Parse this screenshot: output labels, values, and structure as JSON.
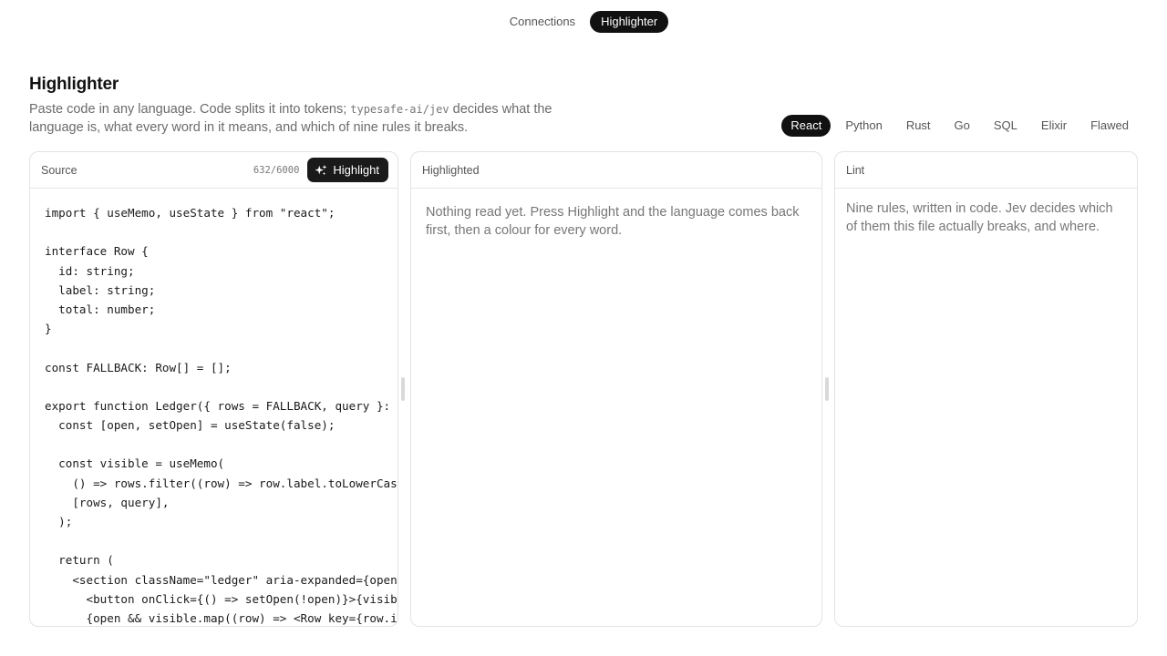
{
  "nav": {
    "tabs": [
      {
        "label": "Connections",
        "active": false
      },
      {
        "label": "Highlighter",
        "active": true
      }
    ]
  },
  "page": {
    "title": "Highlighter",
    "desc_before": "Paste code in any language. Code splits it into tokens; ",
    "desc_code": "typesafe-ai/jev",
    "desc_after": " decides what the language is, what every word in it means, and which of nine rules it breaks."
  },
  "languages": [
    {
      "label": "React",
      "active": true
    },
    {
      "label": "Python",
      "active": false
    },
    {
      "label": "Rust",
      "active": false
    },
    {
      "label": "Go",
      "active": false
    },
    {
      "label": "SQL",
      "active": false
    },
    {
      "label": "Elixir",
      "active": false
    },
    {
      "label": "Flawed",
      "active": false
    }
  ],
  "source": {
    "title": "Source",
    "counter": "632/6000",
    "button_label": "Highlight",
    "button_icon": "sparkles-icon",
    "code_lines": [
      "import { useMemo, useState } from \"react\";",
      "",
      "interface Row {",
      "  id: string;",
      "  label: string;",
      "  total: number;",
      "}",
      "",
      "const FALLBACK: Row[] = [];",
      "",
      "export function Ledger({ rows = FALLBACK, query }: {",
      "  const [open, setOpen] = useState(false);",
      "",
      "  const visible = useMemo(",
      "    () => rows.filter((row) => row.label.toLowerCase",
      "    [rows, query],",
      "  );",
      "",
      "  return (",
      "    <section className=\"ledger\" aria-expanded={open}",
      "      <button onClick={() => setOpen(!open)}>{visibl",
      "      {open && visible.map((row) => <Row key={row.id"
    ]
  },
  "highlighted": {
    "title": "Highlighted",
    "empty_text": "Nothing read yet. Press Highlight and the language comes back first, then a colour for every word."
  },
  "lint": {
    "title": "Lint",
    "empty_text": "Nine rules, written in code. Jev decides which of them this file actually breaks, and where."
  }
}
